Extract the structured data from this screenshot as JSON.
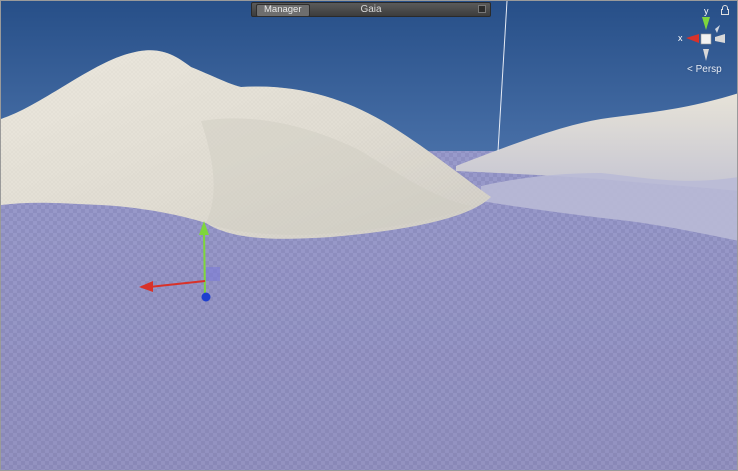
{
  "overlay": {
    "manager_label": "Manager",
    "title": "Gaia"
  },
  "scene_gizmo": {
    "y_label": "y",
    "x_label": "x",
    "projection_label": "Persp",
    "y_color": "#7ed63c",
    "x_color": "#d8322a"
  },
  "colors": {
    "sky_top": "#2f5b93",
    "sky_horizon": "#9fb6d6",
    "terrain_light": "#e4e0d4",
    "terrain_plane": "#8f90c4",
    "checker_dark": "#8a8bb8"
  }
}
